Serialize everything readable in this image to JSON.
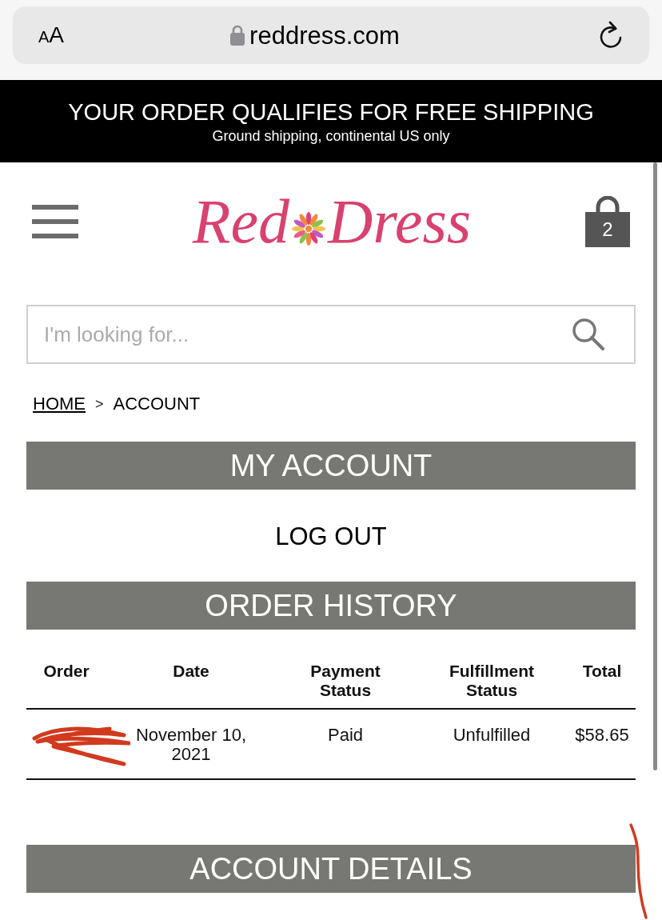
{
  "browser": {
    "text_size_button": "AA",
    "url": "reddress.com"
  },
  "promo_banner": {
    "title": "YOUR ORDER QUALIFIES FOR FREE SHIPPING",
    "subtitle": "Ground shipping, continental US only"
  },
  "header": {
    "logo": {
      "words": [
        "Red",
        "Dress"
      ]
    },
    "cart_count": "2"
  },
  "search": {
    "placeholder": "I'm looking for..."
  },
  "breadcrumb": {
    "separator": ">",
    "items": [
      {
        "label": "HOME",
        "link": true
      },
      {
        "label": "ACCOUNT",
        "link": false
      }
    ]
  },
  "my_account": {
    "heading": "MY ACCOUNT",
    "log_out": "LOG OUT"
  },
  "order_history": {
    "heading": "ORDER HISTORY",
    "columns": [
      "Order",
      "Date",
      "Payment Status",
      "Fulfillment Status",
      "Total"
    ],
    "rows": [
      {
        "order_redacted": true,
        "date": "November 10, 2021",
        "payment_status": "Paid",
        "fulfillment_status": "Unfulfilled",
        "total": "$58.65"
      }
    ]
  },
  "account_details": {
    "heading": "ACCOUNT DETAILS"
  }
}
